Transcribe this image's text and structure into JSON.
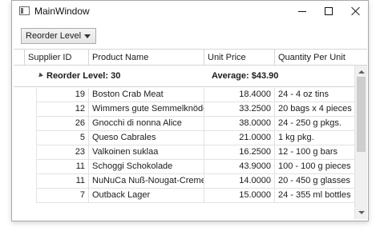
{
  "window": {
    "title": "MainWindow"
  },
  "toolbar": {
    "group_combo_value": "Reorder Level"
  },
  "grid": {
    "columns": [
      "Supplier ID",
      "Product Name",
      "Unit Price",
      "Quantity Per Unit"
    ],
    "group": {
      "title": "Reorder Level: 30",
      "aggregate": "Average: $43.90"
    },
    "rows": [
      {
        "supplier_id": "19",
        "product": "Boston Crab Meat",
        "price": "18.4000",
        "qty": "24 - 4 oz tins"
      },
      {
        "supplier_id": "12",
        "product": "Wimmers gute Semmelknödel",
        "price": "33.2500",
        "qty": "20 bags x 4 pieces"
      },
      {
        "supplier_id": "26",
        "product": "Gnocchi di nonna Alice",
        "price": "38.0000",
        "qty": "24 - 250 g pkgs."
      },
      {
        "supplier_id": "5",
        "product": "Queso Cabrales",
        "price": "21.0000",
        "qty": "1 kg pkg."
      },
      {
        "supplier_id": "23",
        "product": "Valkoinen suklaa",
        "price": "16.2500",
        "qty": "12 - 100 g bars"
      },
      {
        "supplier_id": "11",
        "product": "Schoggi Schokolade",
        "price": "43.9000",
        "qty": "100 - 100 g pieces"
      },
      {
        "supplier_id": "11",
        "product": "NuNuCa Nuß-Nougat-Creme",
        "price": "14.0000",
        "qty": "20 - 450 g glasses"
      },
      {
        "supplier_id": "7",
        "product": "Outback Lager",
        "price": "15.0000",
        "qty": "24 - 355 ml bottles"
      }
    ]
  }
}
